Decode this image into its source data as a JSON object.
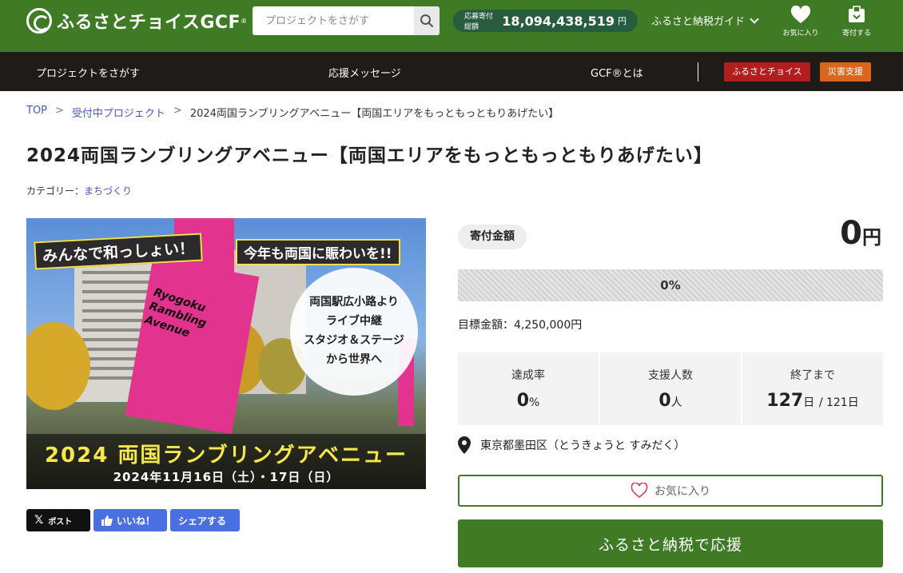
{
  "header": {
    "logo_text": "ふるさとチョイスGCF",
    "logo_mark": "®",
    "search_placeholder": "プロジェクトをさがす",
    "total_label": "応募寄付総額",
    "total_value": "18,094,438,519",
    "total_unit": "円",
    "guide_label": "ふるさと納税ガイド",
    "fav_label": "お気に入り",
    "donate_label": "寄付する"
  },
  "nav": {
    "search": "プロジェクトをさがす",
    "messages": "応援メッセージ",
    "about": "GCF®とは",
    "choice": "ふるさとチョイス",
    "disaster": "災害支援"
  },
  "breadcrumb": {
    "top": "TOP",
    "sep": ">",
    "accepting": "受付中プロジェクト",
    "current": "2024両国ランブリングアベニュー【両国エリアをもっともっともりあげたい】"
  },
  "page": {
    "title": "2024両国ランブリングアベニュー【両国エリアをもっともっともりあげたい】",
    "category_label": "カテゴリー：",
    "category_value": "まちづくり"
  },
  "hero": {
    "banner_left": "みんなで和っしょい！",
    "banner_right": "今年も両国に賑わいを!!",
    "circle_lines": [
      "両国駅広小路より",
      "ライブ中継",
      "スタジオ＆ステージ",
      "から世界へ"
    ],
    "flag_text": "Ryogoku Rambling Avenue",
    "title": "2024 両国ランブリングアベニュー",
    "date": "2024年11月16日（土）・17日（日）"
  },
  "share": {
    "x": "ポスト",
    "like": "いいね！",
    "share": "シェアする"
  },
  "panel": {
    "amount_label": "寄付金額",
    "amount_value": "0",
    "amount_unit": "円",
    "progress_fraction": 0,
    "progress_label": "0%",
    "goal_label": "目標金額：",
    "goal_value": "4,250,000円",
    "stats": {
      "rate_label": "達成率",
      "rate_value": "0",
      "rate_unit": "%",
      "supporters_label": "支援人数",
      "supporters_value": "0",
      "supporters_unit": "人",
      "remaining_label": "終了まで",
      "remaining_value": "127",
      "remaining_unit": "日",
      "remaining_total": "/ 121日"
    },
    "location": "東京都墨田区（とうきょうと すみだく）",
    "favorite_button": "お気に入り",
    "cta_button": "ふるさと納税で応援"
  },
  "colors": {
    "brand_green": "#3f7a25",
    "nav_dark": "#1e1b18",
    "total_pill": "#275c3f",
    "choice_tag": "#b21e1e",
    "disaster_tag": "#d8661f",
    "link": "#4a5bb5",
    "x_button": "#111111",
    "like_button": "#4a6fe0"
  }
}
